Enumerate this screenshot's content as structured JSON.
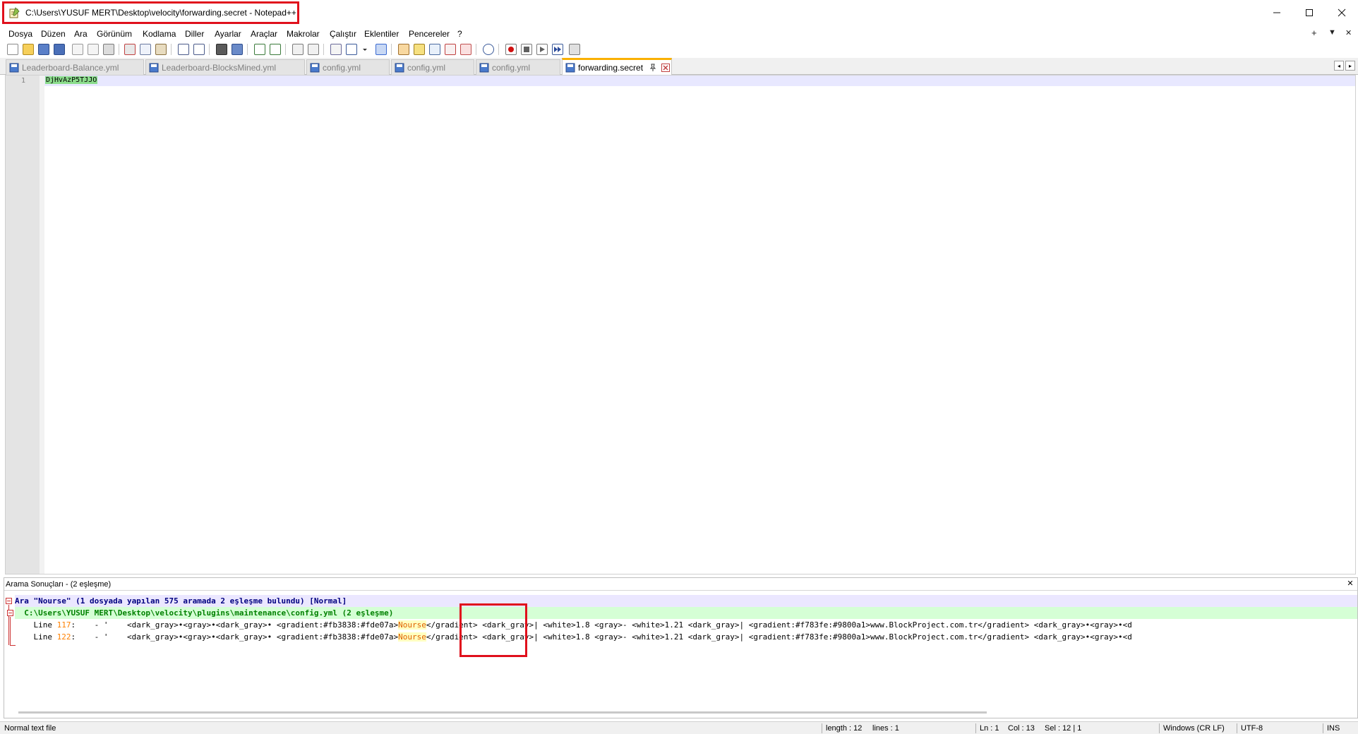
{
  "window": {
    "title": "C:\\Users\\YUSUF MERT\\Desktop\\velocity\\forwarding.secret - Notepad++",
    "minimize_icon": "minimize-icon",
    "maximize_icon": "maximize-icon",
    "close_icon": "close-icon"
  },
  "menu": {
    "items": [
      "Dosya",
      "Düzen",
      "Ara",
      "Görünüm",
      "Kodlama",
      "Diller",
      "Ayarlar",
      "Araçlar",
      "Makrolar",
      "Çalıştır",
      "Eklentiler",
      "Pencereler",
      "?"
    ],
    "right_plus": "+",
    "right_down": "▼",
    "right_close": "✕"
  },
  "tabs": [
    {
      "label": "Leaderboard-Balance.yml",
      "active": false
    },
    {
      "label": "Leaderboard-BlocksMined.yml",
      "active": false
    },
    {
      "label": "config.yml",
      "active": false
    },
    {
      "label": "config.yml",
      "active": false
    },
    {
      "label": "config.yml",
      "active": false
    },
    {
      "label": "forwarding.secret",
      "active": true
    }
  ],
  "editor": {
    "line_number": "1",
    "content": "DjHvAzP5TJJO"
  },
  "search_results": {
    "title": "Arama Sonuçları - (2 eşleşme)",
    "summary": "Ara \"Nourse\" (1 dosyada yapılan 575 aramada 2 eşleşme bulundu) [Normal]",
    "file_line": "  C:\\Users\\YUSUF MERT\\Desktop\\velocity\\plugins\\maintenance\\config.yml (2 eşleşme)",
    "hits": [
      {
        "label": "    Line ",
        "number": "117",
        "prefix": ":    - '    <dark_gray>•<gray>•<dark_gray>• <gradient:#fb3838:#fde07a>",
        "match": "Nourse",
        "suffix": "</gradient> <dark_gray>| <white>1.8 <gray>- <white>1.21 <dark_gray>| <gradient:#f783fe:#9800a1>www.BlockProject.com.tr</gradient> <dark_gray>•<gray>•<d"
      },
      {
        "label": "    Line ",
        "number": "122",
        "prefix": ":    - '    <dark_gray>•<gray>•<dark_gray>• <gradient:#fb3838:#fde07a>",
        "match": "Nourse",
        "suffix": "</gradient> <dark_gray>| <white>1.8 <gray>- <white>1.21 <dark_gray>| <gradient:#f783fe:#9800a1>www.BlockProject.com.tr</gradient> <dark_gray>•<gray>•<d"
      }
    ]
  },
  "status": {
    "file_type": "Normal text file",
    "length": "length : 12",
    "lines": "lines : 1",
    "ln": "Ln : 1",
    "col": "Col : 13",
    "sel": "Sel : 12 | 1",
    "eol": "Windows (CR LF)",
    "encoding": "UTF-8",
    "mode": "INS"
  },
  "colors": {
    "highlight_box": "#e0101c",
    "active_tab_accent": "#fab000",
    "selection": "#8cdd8c"
  }
}
